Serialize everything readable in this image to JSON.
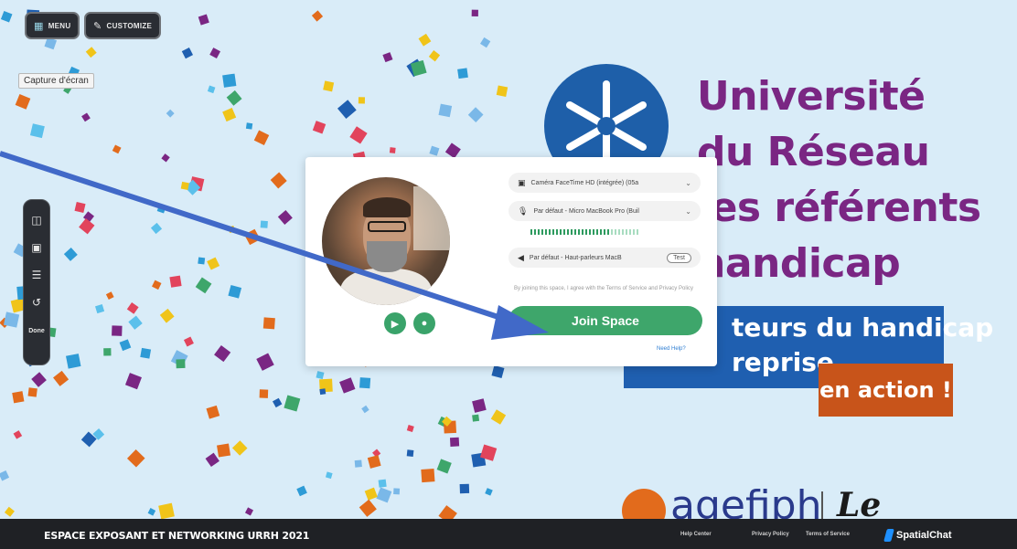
{
  "top_bar": {
    "menu_label": "MENU",
    "customize_label": "CUSTOMIZE"
  },
  "capture_label": "Capture d'écran",
  "left_toolbar": {
    "tools": [
      "layout-icon",
      "screen-icon",
      "sliders-icon",
      "undo-icon"
    ],
    "done_label": "Done"
  },
  "background": {
    "title_lines": [
      "Université",
      "du Réseau",
      "les référents",
      "handicap"
    ],
    "banner_lines": [
      "teurs du handicap",
      "reprise"
    ],
    "banner_action": "en action !",
    "partners": {
      "agefiph": "agefiph",
      "lemonde": "Le Monde"
    }
  },
  "join_modal": {
    "camera_select": "Caméra FaceTime HD (intégrée) (05a",
    "microphone_select": "Par défaut - Micro MacBook Pro (Buil",
    "speaker_select": "Par défaut - Haut-parleurs MacB",
    "test_label": "Test",
    "terms_text": "By joining this space, I agree with the Terms of Service and Privacy Policy",
    "join_label": "Join Space",
    "need_help_label": "Need Help?"
  },
  "footer": {
    "event_title": "ESPACE EXPOSANT ET NETWORKING URRH 2021",
    "help_center": "Help Center",
    "privacy_policy": "Privacy Policy",
    "terms_of_service": "Terms of Service",
    "brand": "SpatialChat"
  },
  "colors": {
    "background": "#d9ecf8",
    "title_purple": "#7a2683",
    "banner_blue": "#1f5fb0",
    "banner_orange": "#c8541a",
    "join_green": "#3ea66b",
    "arrow_blue": "#4169c8"
  }
}
